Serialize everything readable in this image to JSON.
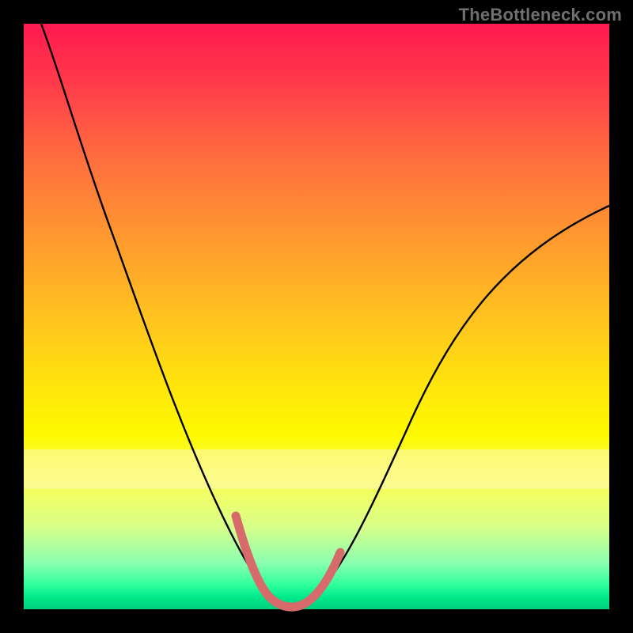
{
  "watermark": "TheBottleneck.com",
  "colors": {
    "background": "#000000",
    "gradient_top": "#ff1a50",
    "gradient_mid": "#ffe80a",
    "gradient_bottom": "#00d080",
    "curve": "#000000",
    "highlight": "#d76a6a"
  },
  "chart_data": {
    "type": "line",
    "title": "",
    "xlabel": "",
    "ylabel": "",
    "xlim": [
      0,
      100
    ],
    "ylim": [
      0,
      100
    ],
    "series": [
      {
        "name": "bottleneck-curve",
        "x": [
          3,
          8,
          13,
          18,
          23,
          28,
          32,
          35,
          37,
          39,
          41,
          43,
          45,
          47,
          49,
          51,
          54,
          58,
          63,
          70,
          78,
          86,
          94,
          100
        ],
        "y": [
          100,
          88,
          76,
          64,
          53,
          42,
          33,
          25,
          18,
          11,
          5,
          1,
          0,
          0,
          1,
          4,
          10,
          18,
          27,
          37,
          47,
          56,
          63,
          68
        ]
      },
      {
        "name": "highlight-segment",
        "x": [
          37,
          39,
          41,
          43,
          45,
          47,
          49,
          51
        ],
        "y": [
          18,
          11,
          5,
          1,
          0,
          0,
          1,
          4
        ]
      }
    ],
    "annotations": []
  }
}
